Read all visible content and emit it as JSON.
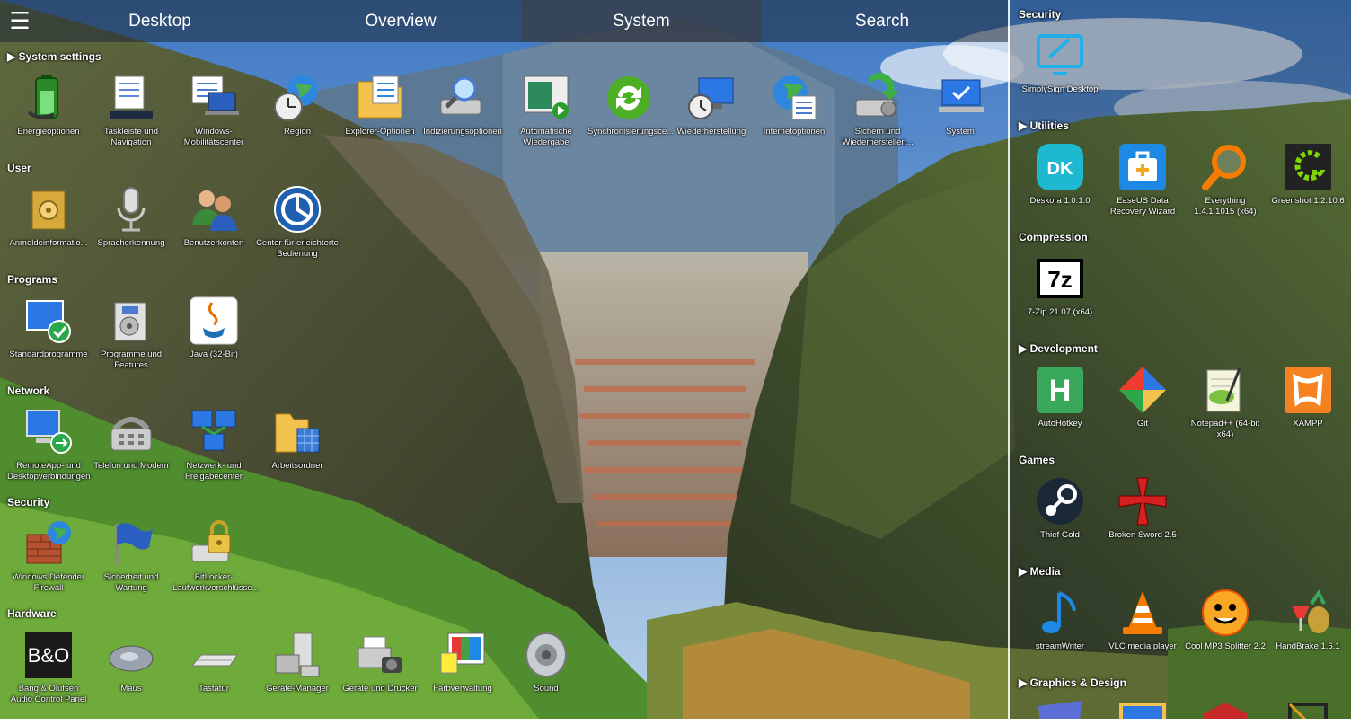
{
  "topbar": {
    "menu_icon": "hamburger-menu-icon",
    "tabs": [
      {
        "label": "Desktop",
        "active": false
      },
      {
        "label": "Overview",
        "active": false
      },
      {
        "label": "System",
        "active": true
      },
      {
        "label": "Search",
        "active": false
      }
    ]
  },
  "left": {
    "sections": [
      {
        "title": "▶ System settings",
        "items": [
          {
            "label": "Energieoptionen",
            "icon": "battery-plug-icon"
          },
          {
            "label": "Taskleiste und Navigation",
            "icon": "taskbar-icon"
          },
          {
            "label": "Windows-Mobilitätscenter",
            "icon": "mobility-center-icon"
          },
          {
            "label": "Region",
            "icon": "globe-clock-icon"
          },
          {
            "label": "Explorer-Optionen",
            "icon": "folder-options-icon"
          },
          {
            "label": "Indizierungsoptionen",
            "icon": "indexing-icon"
          },
          {
            "label": "Automatische Wiedergabe",
            "icon": "autoplay-icon"
          },
          {
            "label": "Synchronisierungsce...",
            "icon": "sync-icon"
          },
          {
            "label": "Wiederherstellung",
            "icon": "recovery-icon"
          },
          {
            "label": "Internetoptionen",
            "icon": "internet-options-icon"
          },
          {
            "label": "Sichern und Wiederherstellen...",
            "icon": "backup-icon"
          },
          {
            "label": "System",
            "icon": "system-icon"
          }
        ]
      },
      {
        "title": "User",
        "items": [
          {
            "label": "Anmeldeinformatio...",
            "icon": "credential-vault-icon"
          },
          {
            "label": "Spracherkennung",
            "icon": "microphone-icon"
          },
          {
            "label": "Benutzerkonten",
            "icon": "user-accounts-icon"
          },
          {
            "label": "Center für erleichterte Bedienung",
            "icon": "ease-of-access-icon"
          }
        ]
      },
      {
        "title": "Programs",
        "items": [
          {
            "label": "Standardprogramme",
            "icon": "default-programs-icon"
          },
          {
            "label": "Programme und Features",
            "icon": "programs-features-icon"
          },
          {
            "label": "Java (32-Bit)",
            "icon": "java-icon"
          }
        ]
      },
      {
        "title": "Network",
        "items": [
          {
            "label": "RemoteApp- und Desktopverbindungen",
            "icon": "remote-desktop-icon"
          },
          {
            "label": "Telefon und Modem",
            "icon": "phone-modem-icon"
          },
          {
            "label": "Netzwerk- und Freigabecenter",
            "icon": "network-center-icon"
          },
          {
            "label": "Arbeitsordner",
            "icon": "work-folders-icon"
          }
        ]
      },
      {
        "title": "Security",
        "items": [
          {
            "label": "Windows Defender Firewall",
            "icon": "firewall-icon"
          },
          {
            "label": "Sicherheit und Wartung",
            "icon": "security-flag-icon"
          },
          {
            "label": "BitLocker-Laufwerkverschlüsse...",
            "icon": "bitlocker-icon"
          }
        ]
      },
      {
        "title": "Hardware",
        "items": [
          {
            "label": "Bang & Olufsen Audio Control Panel",
            "icon": "bang-olufsen-icon"
          },
          {
            "label": "Maus",
            "icon": "mouse-icon"
          },
          {
            "label": "Tastatur",
            "icon": "keyboard-icon"
          },
          {
            "label": "Geräte-Manager",
            "icon": "device-manager-icon"
          },
          {
            "label": "Geräte und Drucker",
            "icon": "printer-icon"
          },
          {
            "label": "Farbverwaltung",
            "icon": "color-management-icon"
          },
          {
            "label": "Sound",
            "icon": "speaker-icon"
          }
        ]
      }
    ]
  },
  "right": {
    "sections": [
      {
        "title": "Security",
        "items": [
          {
            "label": "SimplySign Desktop",
            "icon": "simplysign-icon"
          }
        ]
      },
      {
        "title": "▶ Utilities",
        "items": [
          {
            "label": "Deskora 1.0.1.0",
            "icon": "deskora-icon",
            "glyph": "DK"
          },
          {
            "label": "EaseUS Data Recovery Wizard",
            "icon": "easeus-icon"
          },
          {
            "label": "Everything 1.4.1.1015 (x64)",
            "icon": "magnifier-icon"
          },
          {
            "label": "Greenshot 1.2.10.6",
            "icon": "greenshot-icon"
          }
        ]
      },
      {
        "title": "Compression",
        "items": [
          {
            "label": "7-Zip 21.07 (x64)",
            "icon": "seven-zip-icon",
            "glyph": "7z"
          }
        ]
      },
      {
        "title": "▶ Development",
        "items": [
          {
            "label": "AutoHotkey",
            "icon": "autohotkey-icon",
            "glyph": "H"
          },
          {
            "label": "Git",
            "icon": "git-icon"
          },
          {
            "label": "Notepad++ (64-bit x64)",
            "icon": "notepadpp-icon"
          },
          {
            "label": "XAMPP",
            "icon": "xampp-icon"
          }
        ]
      },
      {
        "title": "Games",
        "items": [
          {
            "label": "Thief Gold",
            "icon": "steam-icon"
          },
          {
            "label": "Broken Sword 2.5",
            "icon": "red-cross-icon"
          }
        ]
      },
      {
        "title": "▶ Media",
        "items": [
          {
            "label": "streamWriter",
            "icon": "music-note-icon"
          },
          {
            "label": "VLC media player",
            "icon": "vlc-cone-icon"
          },
          {
            "label": "Cool MP3 Splitter 2.2",
            "icon": "smiley-icon"
          },
          {
            "label": "HandBrake 1.6.1",
            "icon": "handbrake-icon"
          }
        ]
      },
      {
        "title": "▶ Graphics & Design",
        "items": []
      }
    ]
  }
}
